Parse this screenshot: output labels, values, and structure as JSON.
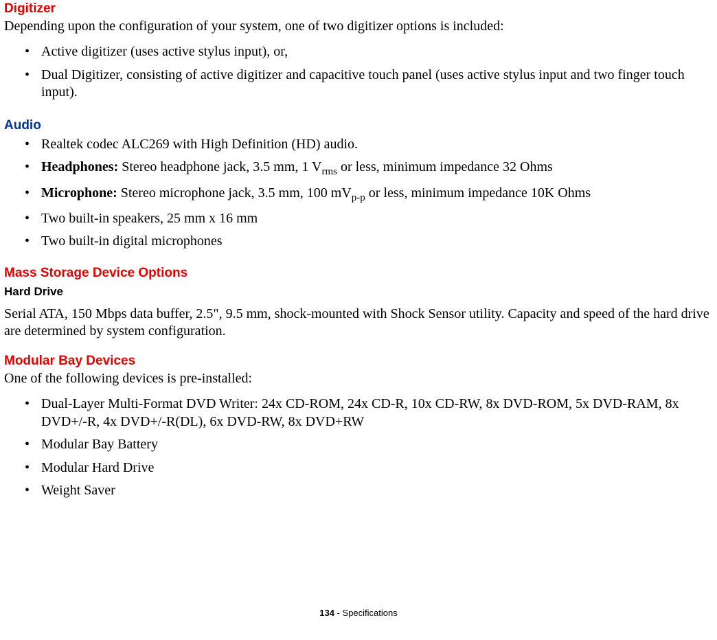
{
  "digitizer": {
    "heading": "Digitizer",
    "intro": "Depending upon the configuration of your system, one of two digitizer options is included:",
    "items": [
      "Active digitizer (uses active stylus input), or,",
      "Dual Digitizer, consisting of active digitizer and capacitive touch panel (uses active stylus input and two finger touch input)."
    ]
  },
  "audio": {
    "heading": "Audio",
    "items": {
      "codec": "Realtek codec ALC269 with High Definition (HD) audio.",
      "headphones_label": "Headphones:",
      "headphones_pre": " Stereo headphone jack, 3.5 mm, 1 V",
      "headphones_sub": "rms",
      "headphones_post": " or less, minimum impedance 32 Ohms",
      "microphone_label": "Microphone:",
      "microphone_pre": " Stereo microphone jack, 3.5 mm, 100 mV",
      "microphone_sub": "p-p",
      "microphone_post": " or less, minimum impedance 10K Ohms",
      "speakers": "Two built-in speakers, 25 mm x 16 mm",
      "mics": "Two built-in digital microphones"
    }
  },
  "mass_storage": {
    "heading": "Mass Storage Device Options",
    "hard_drive_label": "Hard Drive",
    "hard_drive_text": "Serial ATA, 150 Mbps data buffer, 2.5\", 9.5 mm, shock-mounted with Shock Sensor utility. Capacity and speed of the hard drive are determined by system configuration."
  },
  "modular_bay": {
    "heading": "Modular Bay Devices",
    "intro": "One of the following devices is pre-installed:",
    "items": [
      "Dual-Layer Multi-Format DVD Writer: 24x CD-ROM, 24x CD-R, 10x CD-RW, 8x DVD-ROM, 5x DVD-RAM, 8x DVD+/-R, 4x DVD+/-R(DL), 6x DVD-RW, 8x DVD+RW",
      "Modular Bay Battery",
      "Modular Hard Drive",
      "Weight Saver"
    ]
  },
  "footer": {
    "page_number": "134",
    "section": " - Specifications"
  }
}
